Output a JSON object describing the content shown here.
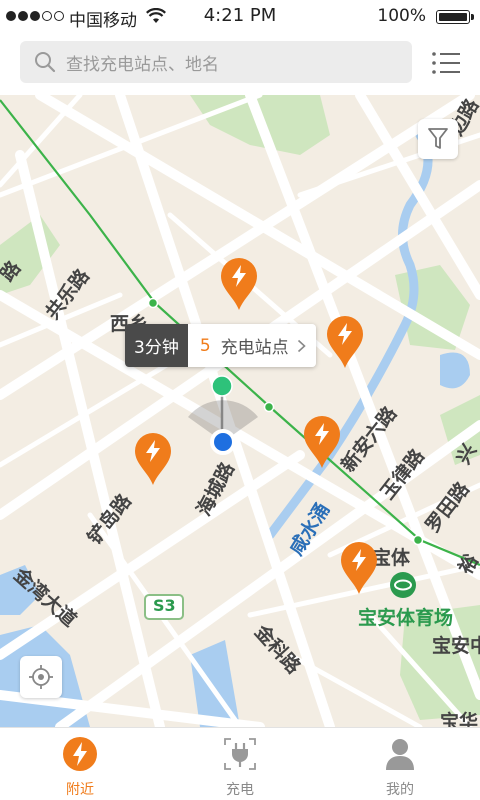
{
  "status_bar": {
    "carrier": "中国移动",
    "time": "4:21 PM",
    "battery": "100%"
  },
  "search": {
    "placeholder": "查找充电站点、地名"
  },
  "map": {
    "labels": {
      "gongle_road": "共乐路",
      "xixiang": "西乡",
      "xinan6_road": "新安六路",
      "haicheng_road": "海城路",
      "xianshuiyong": "咸水涌",
      "yulv_road": "玉律路",
      "luotian_road": "罗田路",
      "chandao_road": "铲岛路",
      "jinwan_avenue": "金湾大道",
      "s3": "S3",
      "jinke_road": "金科路",
      "baoan_stadium": "宝安体育场",
      "baoti": "宝体",
      "baoan_zhong": "宝安中",
      "baohua": "宝华",
      "edge_road_left": "路",
      "edge_road_right": "边路",
      "edge_label_right1": "兴",
      "edge_label_right2": "裕"
    }
  },
  "callout": {
    "time": "3分钟",
    "count": "5",
    "label": "充电站点"
  },
  "tabs": [
    {
      "label": "附近",
      "icon": "bolt-icon",
      "active": true
    },
    {
      "label": "充电",
      "icon": "plug-icon",
      "active": false
    },
    {
      "label": "我的",
      "icon": "user-icon",
      "active": false
    }
  ],
  "colors": {
    "accent": "#f07c1b",
    "map_bg": "#f3ede3",
    "water": "#a9cdf0",
    "park": "#cfe6bf",
    "metro_line": "#3cb34a"
  }
}
